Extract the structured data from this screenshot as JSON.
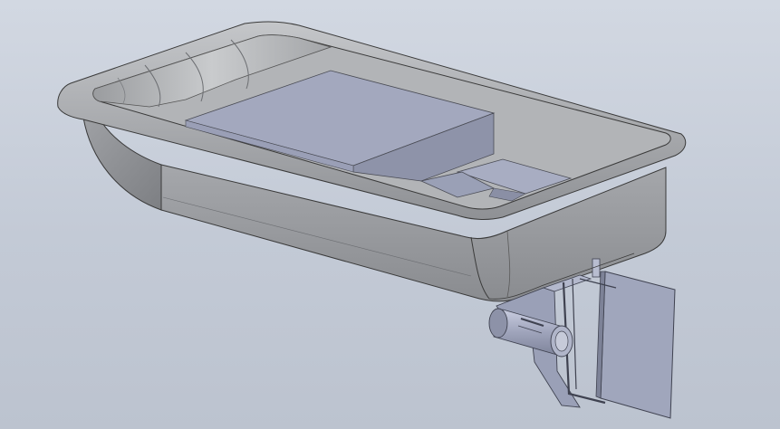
{
  "scene": {
    "type": "cad-3d-model-viewport",
    "objects": [
      {
        "name": "tray-tub",
        "colors": {
          "fill": "#a7a9ad",
          "edge": "#3a3a3a"
        }
      },
      {
        "name": "battery-box-large",
        "colors": {
          "fill": "#9a9fb6"
        }
      },
      {
        "name": "battery-box-small",
        "colors": {
          "fill": "#a2a7bd"
        }
      },
      {
        "name": "mounting-bracket",
        "colors": {
          "fill": "#9aa0b7"
        }
      },
      {
        "name": "motor-cylinder",
        "colors": {
          "fill": "#a8adc2"
        }
      },
      {
        "name": "rudder-plate",
        "colors": {
          "fill": "#a0a6bc"
        }
      }
    ],
    "background": {
      "top": "#d2d8e2",
      "bottom": "#bcc3cf"
    }
  }
}
